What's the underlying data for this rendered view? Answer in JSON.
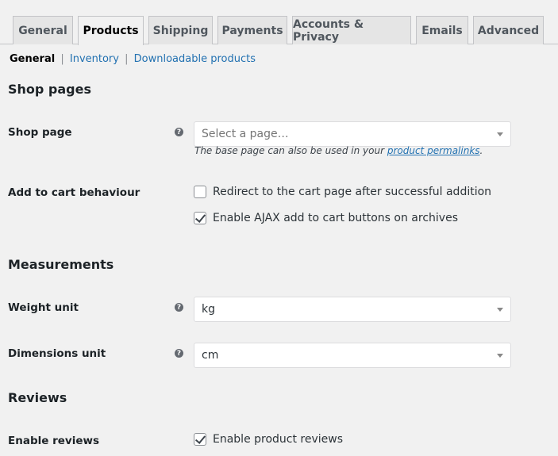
{
  "tabs": [
    "General",
    "Products",
    "Shipping",
    "Payments",
    "Accounts & Privacy",
    "Emails",
    "Advanced"
  ],
  "subnav": {
    "current": "General",
    "links": [
      "Inventory",
      "Downloadable products"
    ],
    "separator": "|"
  },
  "sections": {
    "shop_pages": "Shop pages",
    "measurements": "Measurements",
    "reviews": "Reviews"
  },
  "shop_page": {
    "label": "Shop page",
    "placeholder": "Select a page…",
    "desc_before": "The base page can also be used in your ",
    "desc_link": "product permalinks",
    "desc_after": "."
  },
  "add_to_cart": {
    "label": "Add to cart behaviour",
    "redirect_label": "Redirect to the cart page after successful addition",
    "redirect_checked": false,
    "ajax_label": "Enable AJAX add to cart buttons on archives",
    "ajax_checked": true
  },
  "weight_unit": {
    "label": "Weight unit",
    "value": "kg"
  },
  "dimensions_unit": {
    "label": "Dimensions unit",
    "value": "cm"
  },
  "enable_reviews": {
    "label": "Enable reviews",
    "option_label": "Enable product reviews",
    "checked": true
  },
  "help_glyph": "?",
  "colors": {
    "background": "#f1f1f1",
    "link": "#2271b1",
    "tab_inactive": "#e5e5e5",
    "border": "#c3c4c7"
  }
}
